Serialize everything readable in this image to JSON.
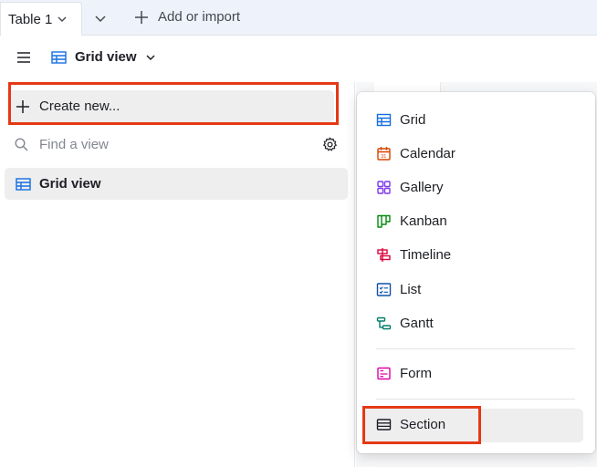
{
  "tabbar": {
    "active_tab": "Table 1",
    "add_import": "Add or import"
  },
  "viewbar": {
    "current_view": "Grid view"
  },
  "sidebar": {
    "create_new": "Create new...",
    "search_placeholder": "Find a view",
    "views": [
      {
        "label": "Grid view",
        "icon": "grid-icon"
      }
    ]
  },
  "dropdown": {
    "items": [
      {
        "label": "Grid",
        "icon": "grid-icon",
        "color": "#166ee1"
      },
      {
        "label": "Calendar",
        "icon": "calendar-icon",
        "color": "#d54401"
      },
      {
        "label": "Gallery",
        "icon": "gallery-icon",
        "color": "#7c37ef"
      },
      {
        "label": "Kanban",
        "icon": "kanban-icon",
        "color": "#048a0e"
      },
      {
        "label": "Timeline",
        "icon": "timeline-icon",
        "color": "#dc043b"
      },
      {
        "label": "List",
        "icon": "list-icon",
        "color": "#0d52ac"
      },
      {
        "label": "Gantt",
        "icon": "gantt-icon",
        "color": "#017e6b"
      },
      {
        "label": "Form",
        "icon": "form-icon",
        "color": "#dd04a8"
      },
      {
        "label": "Section",
        "icon": "section-icon",
        "color": "#1d1f25"
      }
    ]
  },
  "colors": {
    "highlight": "#e53915",
    "tabbar_bg": "#eef2fb",
    "selected_bg": "#eeeeee"
  }
}
